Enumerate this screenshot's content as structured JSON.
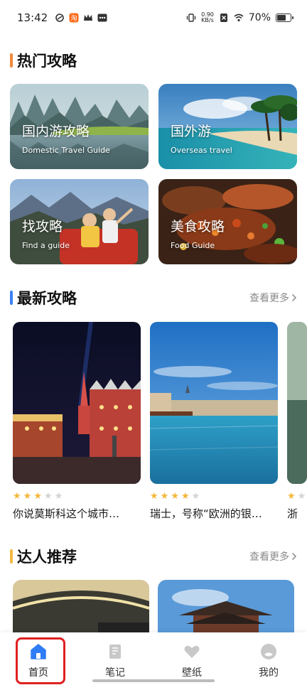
{
  "status_bar": {
    "time": "13:42",
    "net_speed_value": "0.90",
    "net_speed_unit": "KB/s",
    "battery": "70%",
    "battery_level": 0.7
  },
  "hot": {
    "title": "热门攻略",
    "accent": "#f08a3c",
    "cards": [
      {
        "title": "国内游攻略",
        "subtitle": "Domestic Travel Guide"
      },
      {
        "title": "国外游",
        "subtitle": "Overseas travel"
      },
      {
        "title": "找攻略",
        "subtitle": "Find a guide"
      },
      {
        "title": "美食攻略",
        "subtitle": "Food Guide"
      }
    ]
  },
  "latest": {
    "title": "最新攻略",
    "accent": "#3b82f6",
    "more": "查看更多",
    "items": [
      {
        "title": "你说莫斯科这个城市…",
        "rating": 3
      },
      {
        "title": "瑞士，号称“欧洲的银…",
        "rating": 4
      },
      {
        "title": "浙",
        "rating": 1
      }
    ]
  },
  "experts": {
    "title": "达人推荐",
    "accent": "#f5b942",
    "more": "查看更多"
  },
  "tabs": [
    {
      "label": "首页",
      "icon": "home-icon",
      "active": true
    },
    {
      "label": "笔记",
      "icon": "note-icon",
      "active": false
    },
    {
      "label": "壁纸",
      "icon": "heart-icon",
      "active": false
    },
    {
      "label": "我的",
      "icon": "profile-icon",
      "active": false
    }
  ]
}
